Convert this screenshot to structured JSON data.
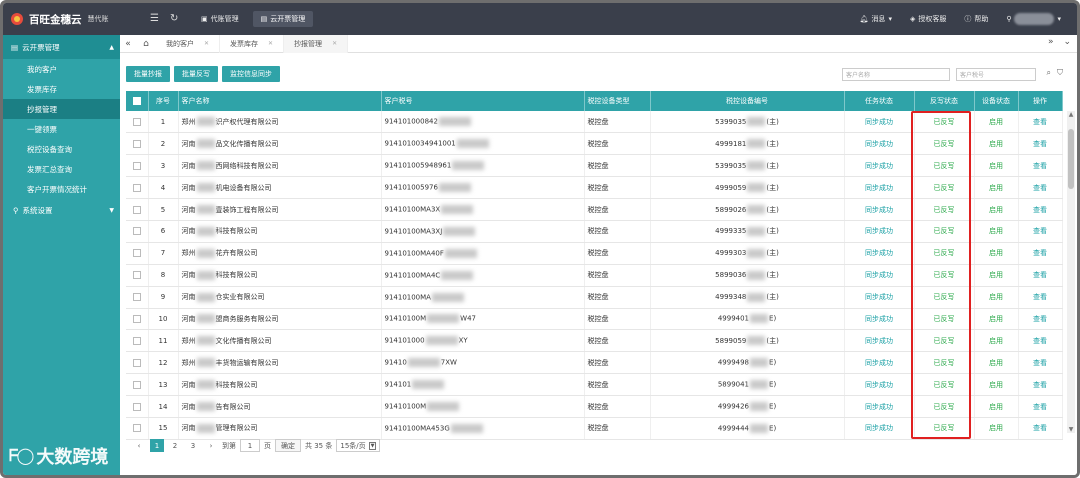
{
  "app": {
    "logo_text": "百旺金穗云",
    "logo_sub": "慧代账",
    "top_tabs": [
      {
        "label": "代账管理",
        "active": false
      },
      {
        "label": "云开票管理",
        "active": true
      }
    ],
    "top_right": {
      "messages": "消息",
      "support": "授权客服",
      "help": "帮助"
    }
  },
  "sidebar": {
    "group_label": "云开票管理",
    "items": [
      {
        "label": "我的客户",
        "active": false
      },
      {
        "label": "发票库存",
        "active": false
      },
      {
        "label": "抄报管理",
        "active": true
      },
      {
        "label": "一键领票",
        "active": false
      },
      {
        "label": "税控设备查询",
        "active": false
      },
      {
        "label": "发票汇总查询",
        "active": false
      },
      {
        "label": "客户开票情况统计",
        "active": false
      }
    ],
    "group2_label": "系统设置",
    "watermark": "大数跨境"
  },
  "page_tabs": [
    {
      "label": "我的客户",
      "active": false
    },
    {
      "label": "发票库存",
      "active": false
    },
    {
      "label": "抄报管理",
      "active": true
    }
  ],
  "toolbar": {
    "batch_copy": "批量抄报",
    "batch_writeback": "批量反写",
    "monitor_sync": "监控信息同步",
    "search_name_placeholder": "客户名称",
    "search_tax_placeholder": "客户税号"
  },
  "table": {
    "columns": [
      "序号",
      "客户名称",
      "客户税号",
      "税控设备类型",
      "税控设备编号",
      "任务状态",
      "反写状态",
      "设备状态",
      "操作"
    ],
    "rows": [
      {
        "no": "1",
        "name_a": "郑州",
        "name_b": "识产权代理有限公司",
        "tax": "914101000842",
        "type": "税控盘",
        "dev_a": "5399035",
        "dev_b": "(主)",
        "task": "同步成功",
        "write": "已反写",
        "state": "启用",
        "op": "查看"
      },
      {
        "no": "2",
        "name_a": "河南",
        "name_b": "品文化传播有限公司",
        "tax": "9141010034941001",
        "type": "税控盘",
        "dev_a": "4999181",
        "dev_b": "(主)",
        "task": "同步成功",
        "write": "已反写",
        "state": "启用",
        "op": "查看"
      },
      {
        "no": "3",
        "name_a": "河南",
        "name_b": "西网络科技有限公司",
        "tax": "914101005948961",
        "type": "税控盘",
        "dev_a": "5399035",
        "dev_b": "(主)",
        "task": "同步成功",
        "write": "已反写",
        "state": "启用",
        "op": "查看"
      },
      {
        "no": "4",
        "name_a": "河南",
        "name_b": "机电设备有限公司",
        "tax": "914101005976",
        "type": "税控盘",
        "dev_a": "4999059",
        "dev_b": "(主)",
        "task": "同步成功",
        "write": "已反写",
        "state": "启用",
        "op": "查看"
      },
      {
        "no": "5",
        "name_a": "河南",
        "name_b": "壹装饰工程有限公司",
        "tax": "91410100MA3X",
        "type": "税控盘",
        "dev_a": "5899026",
        "dev_b": "(主)",
        "task": "同步成功",
        "write": "已反写",
        "state": "启用",
        "op": "查看"
      },
      {
        "no": "6",
        "name_a": "河南",
        "name_b": "科技有限公司",
        "tax": "91410100MA3XJ",
        "type": "税控盘",
        "dev_a": "4999335",
        "dev_b": "(主)",
        "task": "同步成功",
        "write": "已反写",
        "state": "启用",
        "op": "查看"
      },
      {
        "no": "7",
        "name_a": "郑州",
        "name_b": "花卉有限公司",
        "tax": "91410100MA40F",
        "type": "税控盘",
        "dev_a": "4999303",
        "dev_b": "(主)",
        "task": "同步成功",
        "write": "已反写",
        "state": "启用",
        "op": "查看"
      },
      {
        "no": "8",
        "name_a": "河南",
        "name_b": "科技有限公司",
        "tax": "91410100MA4C",
        "type": "税控盘",
        "dev_a": "5899036",
        "dev_b": "(主)",
        "task": "同步成功",
        "write": "已反写",
        "state": "启用",
        "op": "查看"
      },
      {
        "no": "9",
        "name_a": "河南",
        "name_b": "仓实业有限公司",
        "tax": "91410100MA",
        "type": "税控盘",
        "dev_a": "4999348",
        "dev_b": "(主)",
        "task": "同步成功",
        "write": "已反写",
        "state": "启用",
        "op": "查看"
      },
      {
        "no": "10",
        "name_a": "河南",
        "name_b": "盟商务服务有限公司",
        "tax": "91410100M",
        "tax_b": "W47",
        "type": "税控盘",
        "dev_a": "4999401",
        "dev_b": "E)",
        "task": "同步成功",
        "write": "已反写",
        "state": "启用",
        "op": "查看"
      },
      {
        "no": "11",
        "name_a": "郑州",
        "name_b": "文化传播有限公司",
        "tax": "914101000",
        "tax_b": "XY",
        "type": "税控盘",
        "dev_a": "5899059",
        "dev_b": "(主)",
        "task": "同步成功",
        "write": "已反写",
        "state": "启用",
        "op": "查看"
      },
      {
        "no": "12",
        "name_a": "郑州",
        "name_b": "丰货物运输有限公司",
        "tax": "91410",
        "tax_b": "7XW",
        "type": "税控盘",
        "dev_a": "4999498",
        "dev_b": "E)",
        "task": "同步成功",
        "write": "已反写",
        "state": "启用",
        "op": "查看"
      },
      {
        "no": "13",
        "name_a": "河南",
        "name_b": "科技有限公司",
        "tax": "914101",
        "type": "税控盘",
        "dev_a": "5899041",
        "dev_b": "E)",
        "task": "同步成功",
        "write": "已反写",
        "state": "启用",
        "op": "查看"
      },
      {
        "no": "14",
        "name_a": "河南",
        "name_b": "告有限公司",
        "tax": "91410100M",
        "type": "税控盘",
        "dev_a": "4999426",
        "dev_b": "E)",
        "task": "同步成功",
        "write": "已反写",
        "state": "启用",
        "op": "查看"
      },
      {
        "no": "15",
        "name_a": "河南",
        "name_b": "管理有限公司",
        "tax": "91410100MA453G",
        "type": "税控盘",
        "dev_a": "4999444",
        "dev_b": "E)",
        "task": "同步成功",
        "write": "已反写",
        "state": "启用",
        "op": "查看"
      }
    ]
  },
  "pager": {
    "pages": [
      "1",
      "2",
      "3"
    ],
    "goto_label": "到第",
    "goto_value": "1",
    "page_unit": "页",
    "confirm": "确定",
    "total": "共 35 条",
    "page_size": "15条/页"
  },
  "colors": {
    "primary": "#2fa3a8",
    "topbar": "#3a3f4b",
    "success": "#2aa84a",
    "highlight": "#e02020"
  }
}
